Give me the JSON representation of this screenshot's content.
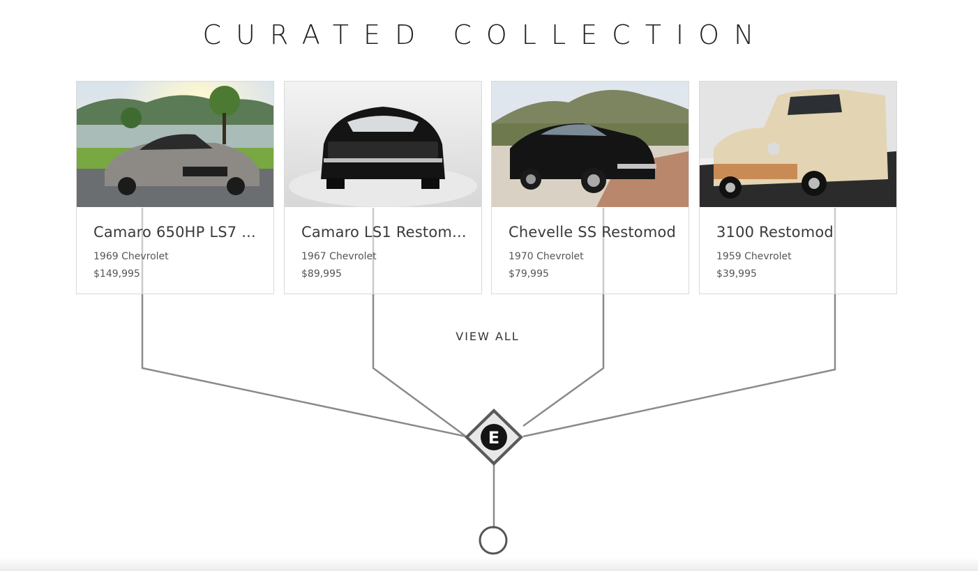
{
  "section": {
    "title": "CURATED COLLECTION",
    "view_all_label": "VIEW ALL"
  },
  "cards": [
    {
      "title": "Camaro 650HP LS7 ...",
      "subtitle": "1969 Chevrolet",
      "price": "$149,995"
    },
    {
      "title": "Camaro LS1 Restom...",
      "subtitle": "1967 Chevrolet",
      "price": "$89,995"
    },
    {
      "title": "Chevelle SS Restomod",
      "subtitle": "1970 Chevrolet",
      "price": "$79,995"
    },
    {
      "title": "3100 Restomod",
      "subtitle": "1959 Chevrolet",
      "price": "$39,995"
    }
  ],
  "logo": {
    "letter": "E"
  },
  "colors": {
    "line": "#8a8a8a",
    "card_border": "#d9d9d9",
    "title": "#1e1e1e"
  }
}
